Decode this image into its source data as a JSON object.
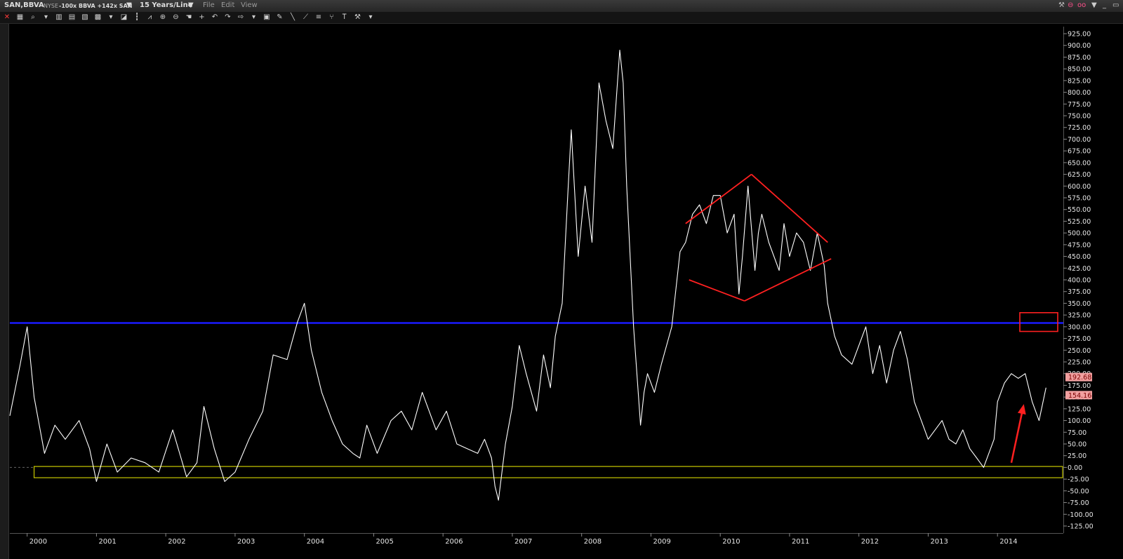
{
  "header": {
    "symbol": "SAN,BBVA",
    "exchange": "NYSE",
    "formula": "-100x BBVA +142x SAN",
    "period": "15 Years/Line",
    "menu": [
      "File",
      "Edit",
      "View"
    ]
  },
  "colors": {
    "background": "#000000",
    "line": "#ffffff",
    "resistance": "#1a1aff",
    "annotation": "#ff2020",
    "support_box": "#c8c800",
    "price_tag": "#f2a0a0"
  },
  "toolbar_icons": [
    "close-icon",
    "grid-icon",
    "zoom-icon",
    "dropdown-icon",
    "chart-type-icon",
    "table-icon",
    "news-icon",
    "layout-icon",
    "dropdown-icon",
    "draw-icon",
    "bars-icon",
    "indicator-icon",
    "zoom-in-icon",
    "zoom-out-icon",
    "hand-icon",
    "crosshair-icon",
    "undo-icon",
    "redo-icon",
    "arrow-icon",
    "dropdown-icon",
    "scan-icon",
    "paint-icon",
    "line-icon",
    "trend-icon",
    "fib-icon",
    "fork-icon",
    "text-icon",
    "tool-icon",
    "dropdown-icon"
  ],
  "chart_data": {
    "type": "line",
    "y_ticks": [
      "925.00",
      "900.00",
      "875.00",
      "850.00",
      "825.00",
      "800.00",
      "775.00",
      "750.00",
      "725.00",
      "700.00",
      "675.00",
      "650.00",
      "625.00",
      "600.00",
      "575.00",
      "550.00",
      "525.00",
      "500.00",
      "475.00",
      "450.00",
      "425.00",
      "400.00",
      "375.00",
      "350.00",
      "325.00",
      "300.00",
      "275.00",
      "250.00",
      "225.00",
      "200.00",
      "175.00",
      "150.00",
      "125.00",
      "100.00",
      "75.00",
      "50.00",
      "25.00",
      "0.00",
      "-25.00",
      "-50.00",
      "-75.00",
      "-100.00",
      "-125.00"
    ],
    "x_ticks": [
      "2000",
      "2001",
      "2002",
      "2003",
      "2004",
      "2005",
      "2006",
      "2007",
      "2008",
      "2009",
      "2010",
      "2011",
      "2012",
      "2013",
      "2014"
    ],
    "ylim": [
      -140,
      940
    ],
    "xlim": [
      1999.75,
      2014.95
    ],
    "price_tags": [
      "192.68",
      "154.16"
    ],
    "x": [
      1999.75,
      1999.9,
      2000.0,
      2000.1,
      2000.25,
      2000.4,
      2000.55,
      2000.75,
      2000.9,
      2001.0,
      2001.15,
      2001.3,
      2001.5,
      2001.7,
      2001.9,
      2002.1,
      2002.3,
      2002.45,
      2002.55,
      2002.7,
      2002.85,
      2003.0,
      2003.2,
      2003.4,
      2003.55,
      2003.75,
      2003.9,
      2004.0,
      2004.1,
      2004.25,
      2004.4,
      2004.55,
      2004.7,
      2004.8,
      2004.9,
      2005.05,
      2005.25,
      2005.4,
      2005.55,
      2005.7,
      2005.9,
      2006.05,
      2006.2,
      2006.35,
      2006.5,
      2006.6,
      2006.7,
      2006.75,
      2006.8,
      2006.9,
      2007.0,
      2007.1,
      2007.2,
      2007.35,
      2007.45,
      2007.55,
      2007.62,
      2007.72,
      2007.8,
      2007.85,
      2007.95,
      2008.05,
      2008.15,
      2008.25,
      2008.35,
      2008.45,
      2008.55,
      2008.6,
      2008.65,
      2008.75,
      2008.85,
      2008.9,
      2008.95,
      2009.05,
      2009.15,
      2009.3,
      2009.42,
      2009.5,
      2009.6,
      2009.7,
      2009.8,
      2009.9,
      2010.0,
      2010.1,
      2010.2,
      2010.27,
      2010.32,
      2010.4,
      2010.5,
      2010.55,
      2010.6,
      2010.7,
      2010.85,
      2010.92,
      2011.0,
      2011.1,
      2011.2,
      2011.3,
      2011.4,
      2011.5,
      2011.55,
      2011.65,
      2011.75,
      2011.9,
      2012.0,
      2012.1,
      2012.2,
      2012.3,
      2012.4,
      2012.5,
      2012.6,
      2012.7,
      2012.8,
      2012.9,
      2013.0,
      2013.1,
      2013.2,
      2013.3,
      2013.4,
      2013.5,
      2013.6,
      2013.7,
      2013.8,
      2013.95,
      2014.0,
      2014.1,
      2014.2,
      2014.3,
      2014.4,
      2014.5,
      2014.6,
      2014.7,
      2014.75,
      2014.82
    ],
    "y": [
      110,
      220,
      300,
      150,
      30,
      90,
      60,
      100,
      40,
      -30,
      50,
      -10,
      20,
      10,
      -10,
      80,
      -20,
      10,
      130,
      40,
      -30,
      -10,
      60,
      120,
      240,
      230,
      310,
      350,
      250,
      160,
      100,
      50,
      30,
      20,
      90,
      30,
      100,
      120,
      80,
      160,
      80,
      120,
      50,
      40,
      30,
      60,
      20,
      -40,
      -70,
      50,
      130,
      260,
      200,
      120,
      240,
      170,
      280,
      350,
      580,
      720,
      450,
      600,
      480,
      820,
      740,
      680,
      890,
      820,
      600,
      300,
      90,
      160,
      200,
      160,
      220,
      300,
      460,
      480,
      540,
      560,
      520,
      580,
      580,
      500,
      540,
      370,
      450,
      600,
      420,
      500,
      540,
      480,
      420,
      520,
      450,
      500,
      480,
      420,
      500,
      430,
      350,
      280,
      240,
      220,
      260,
      300,
      200,
      260,
      180,
      250,
      290,
      230,
      140,
      100,
      60,
      80,
      100,
      60,
      50,
      80,
      40,
      20,
      0,
      60,
      140,
      180,
      200,
      190,
      200,
      140,
      100,
      170
    ]
  },
  "annotations": {
    "resistance_level": 308,
    "support_box": {
      "y_top": 2,
      "y_bottom": -22,
      "x_start": 2000.1,
      "x_end": 2015.2
    },
    "diamond": {
      "left": [
        2009.5,
        520
      ],
      "top": [
        2010.45,
        625
      ],
      "right": [
        2011.6,
        445
      ],
      "bottom": [
        2010.35,
        355
      ],
      "left_low": [
        2009.55,
        400
      ],
      "right_high": [
        2011.55,
        480
      ]
    },
    "box_price": {
      "x": 2014.9,
      "y_top": 330,
      "y_bottom": 290
    },
    "arrow": {
      "from": [
        2014.2,
        10
      ],
      "to": [
        2014.38,
        135
      ]
    }
  }
}
